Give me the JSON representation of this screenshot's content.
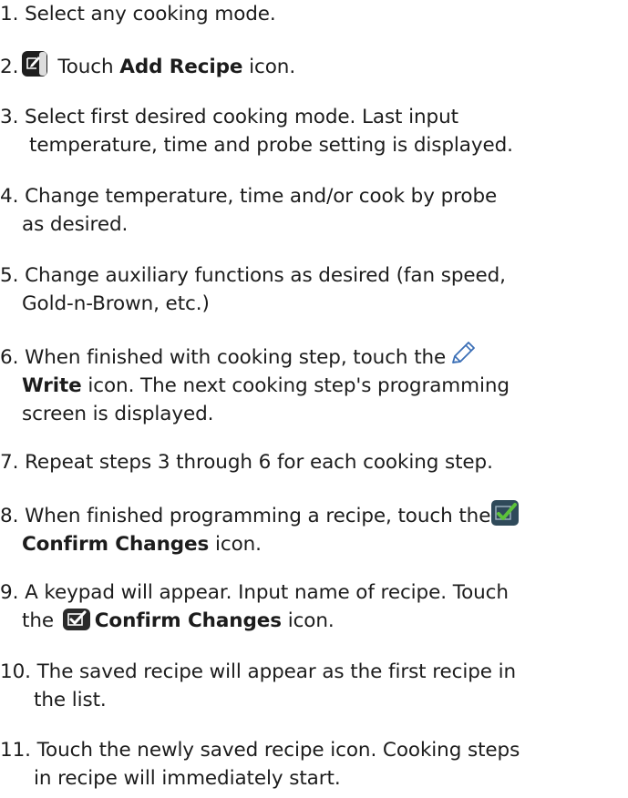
{
  "steps": [
    {
      "num": "1.",
      "lines": [
        "Select any cooking mode."
      ]
    },
    {
      "num": "2.",
      "pre": "Touch ",
      "bold": "Add Recipe",
      "post": " icon.",
      "icon": "add-recipe-icon"
    },
    {
      "num": "3.",
      "first": " Select first desired cooking mode. Last input",
      "second": "temperature, time and probe setting is displayed."
    },
    {
      "num": "4.",
      "first": "Change temperature, time and/or cook by probe",
      "second": "as desired."
    },
    {
      "num": "5.",
      "first": "Change auxiliary functions as desired (fan speed,",
      "second": "Gold-n-Brown, etc.)"
    },
    {
      "num": "6.",
      "first": "When finished with cooking step, touch the",
      "bold": "Write",
      "second_post": " icon. The next cooking step's programming",
      "third": "screen is displayed.",
      "icon": "write-pencil-icon"
    },
    {
      "num": "7.",
      "lines": [
        "Repeat steps 3 through 6 for each cooking step."
      ]
    },
    {
      "num": "8.",
      "first": "When finished programming a recipe, touch the",
      "bold": "Confirm Changes",
      "second_post": " icon.",
      "icon": "confirm-changes-icon"
    },
    {
      "num": "9.",
      "first": "A keypad will appear. Input name of recipe. Touch",
      "second_pre": "the ",
      "bold": "Confirm Changes",
      "second_post": " icon.",
      "icon": "confirm-changes-icon"
    },
    {
      "num": "10.",
      "first": "The saved recipe will appear as the first recipe in",
      "second": "the list."
    },
    {
      "num": "11.",
      "first": "Touch the newly saved recipe icon. Cooking steps",
      "second": "in recipe will immediately start."
    }
  ],
  "colors": {
    "text": "#1c1c1c",
    "pencil_stroke": "#3b6fb6",
    "confirm_bg": "#2f4a5a",
    "confirm_check": "#5cc23a",
    "add_bg": "#1e1e1e"
  }
}
